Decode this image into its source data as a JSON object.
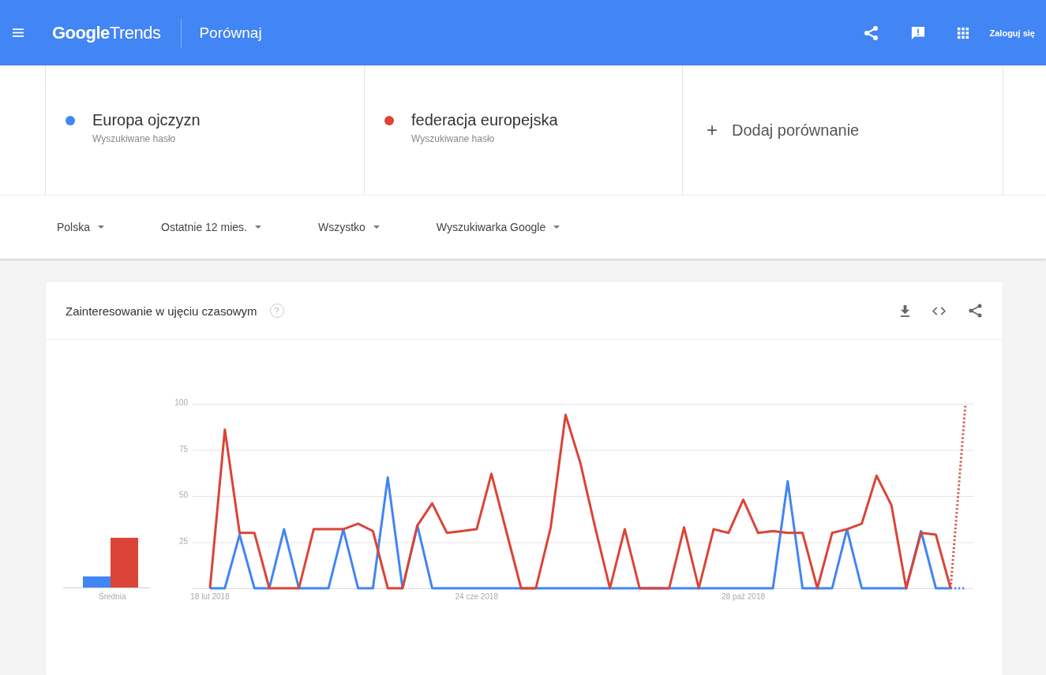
{
  "header": {
    "logo_bold": "Google",
    "logo_light": "Trends",
    "page": "Porównaj",
    "signin": "Zaloguj się"
  },
  "terms": [
    {
      "name": "Europa ojczyzn",
      "caption": "Wyszukiwane hasło",
      "color": "#4285f4"
    },
    {
      "name": "federacja europejska",
      "caption": "Wyszukiwane hasło",
      "color": "#db4437"
    }
  ],
  "add_comparison": {
    "icon": "+",
    "label": "Dodaj porównanie"
  },
  "filters": [
    "Polska",
    "Ostatnie 12 mies.",
    "Wszystko",
    "Wyszukiwarka Google"
  ],
  "card": {
    "title": "Zainteresowanie w ujęciu czasowym",
    "help": "?",
    "average": {
      "label": "Średnia",
      "bars": [
        {
          "color": "#4285f4"
        },
        {
          "color": "#db4437"
        }
      ]
    },
    "chart_data": {
      "type": "line",
      "grid": true,
      "categories": [
        "18 lut 2018",
        null,
        null,
        null,
        null,
        null,
        null,
        null,
        null,
        null,
        null,
        null,
        null,
        null,
        null,
        null,
        null,
        null,
        "24 cze 2018",
        null,
        null,
        null,
        null,
        null,
        null,
        null,
        null,
        null,
        null,
        null,
        null,
        null,
        null,
        null,
        null,
        null,
        "28 paź 2018",
        null,
        null,
        null,
        null,
        null,
        null,
        null,
        null,
        null,
        null,
        null,
        null,
        null,
        null,
        null
      ],
      "ylim": [
        0,
        100
      ],
      "yticks": [
        25,
        50,
        75,
        100
      ],
      "series": [
        {
          "color": "#4285f4",
          "values": [
            0,
            0,
            29,
            0,
            0,
            32,
            0,
            0,
            0,
            32,
            0,
            0,
            60,
            0,
            34,
            0,
            0,
            0,
            0,
            0,
            0,
            0,
            0,
            0,
            0,
            0,
            0,
            0,
            0,
            0,
            0,
            0,
            0,
            0,
            0,
            0,
            0,
            0,
            0,
            58,
            0,
            0,
            0,
            32,
            0,
            0,
            0,
            0,
            31,
            0,
            0,
            0
          ]
        },
        {
          "color": "#db4437",
          "values": [
            0,
            86,
            30,
            30,
            0,
            0,
            0,
            32,
            32,
            32,
            35,
            31,
            0,
            0,
            34,
            46,
            30,
            31,
            32,
            62,
            31,
            0,
            0,
            33,
            94,
            68,
            33,
            0,
            32,
            0,
            0,
            0,
            33,
            0,
            32,
            30,
            48,
            30,
            31,
            30,
            30,
            0,
            30,
            32,
            35,
            61,
            45,
            0,
            30,
            29,
            0,
            100
          ]
        }
      ]
    }
  }
}
